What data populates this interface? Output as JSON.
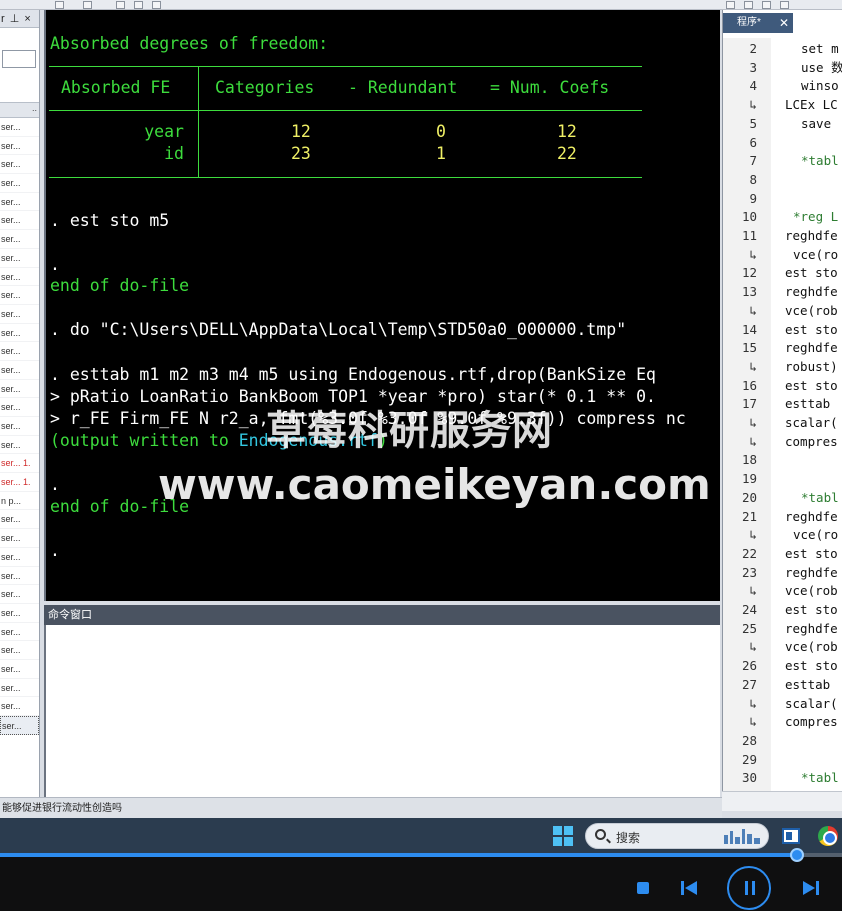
{
  "left_panel": {
    "header": "r ⊥ ×",
    "col_header": "..",
    "rows": [
      {
        "text": "ser...",
        "style": "normal"
      },
      {
        "text": "ser...",
        "style": "normal"
      },
      {
        "text": "ser...",
        "style": "normal"
      },
      {
        "text": "ser...",
        "style": "normal"
      },
      {
        "text": "ser...",
        "style": "normal"
      },
      {
        "text": "ser...",
        "style": "normal"
      },
      {
        "text": "ser...",
        "style": "normal"
      },
      {
        "text": "ser...",
        "style": "normal"
      },
      {
        "text": "ser...",
        "style": "normal"
      },
      {
        "text": "ser...",
        "style": "normal"
      },
      {
        "text": "ser...",
        "style": "normal"
      },
      {
        "text": "ser...",
        "style": "normal"
      },
      {
        "text": "ser...",
        "style": "normal"
      },
      {
        "text": "ser...",
        "style": "normal"
      },
      {
        "text": "ser...",
        "style": "normal"
      },
      {
        "text": "ser...",
        "style": "normal"
      },
      {
        "text": "ser...",
        "style": "normal"
      },
      {
        "text": "ser...",
        "style": "normal"
      },
      {
        "text": "ser... 1.",
        "style": "red"
      },
      {
        "text": "ser... 1.",
        "style": "red"
      },
      {
        "text": "n p...",
        "style": "normal"
      },
      {
        "text": "ser...",
        "style": "normal"
      },
      {
        "text": "ser...",
        "style": "normal"
      },
      {
        "text": "ser...",
        "style": "normal"
      },
      {
        "text": "ser...",
        "style": "normal"
      },
      {
        "text": "ser...",
        "style": "normal"
      },
      {
        "text": "ser...",
        "style": "normal"
      },
      {
        "text": "ser...",
        "style": "normal"
      },
      {
        "text": "ser...",
        "style": "normal"
      },
      {
        "text": "ser...",
        "style": "normal"
      },
      {
        "text": "ser...",
        "style": "normal"
      },
      {
        "text": "ser...",
        "style": "normal"
      },
      {
        "text": "ser...",
        "style": "sel"
      }
    ]
  },
  "results": {
    "absorbed_title": "Absorbed degrees of freedom:",
    "table": {
      "headers": [
        "Absorbed FE",
        "Categories",
        "- Redundant",
        "= Num. Coefs"
      ],
      "rows": [
        {
          "fe": "year",
          "categories": "12",
          "redundant": "0",
          "coefs": "12"
        },
        {
          "fe": "id",
          "categories": "23",
          "redundant": "1",
          "coefs": "22"
        }
      ]
    },
    "cmd_est_sto": ". est sto m5",
    "dot1": ".",
    "end_do1": "end of do-file",
    "cmd_do": ". do \"C:\\Users\\DELL\\AppData\\Local\\Temp\\STD50a0_000000.tmp\"",
    "cmd_esttab": ". esttab m1 m2 m3 m4 m5 using Endogenous.rtf,drop(BankSize Eq",
    "cont1": "> pRatio LoanRatio BankBoom TOP1 *year *pro) star(* 0.1 ** 0.",
    "cont2": "> r_FE Firm_FE N r2_a, fmt(%3.0f %3.0f %9.0f %9.3f)) compress nc",
    "output_prefix": "(output written to ",
    "output_file": "Endogenous.rtf",
    "output_suffix": ")",
    "dot2": ".",
    "end_do2": "end of do-file",
    "dot3": "."
  },
  "command_window": {
    "title": "命令窗口"
  },
  "editor": {
    "tab_label": "程序*",
    "lines": [
      {
        "num": "2",
        "code": "set m",
        "style": "code",
        "indent": 1
      },
      {
        "num": "3",
        "code": "use 数",
        "style": "code",
        "indent": 1
      },
      {
        "num": "4",
        "code": "winso",
        "style": "code",
        "indent": 1
      },
      {
        "num": "↳",
        "code": "LCEx LC",
        "style": "code",
        "indent": 0
      },
      {
        "num": "5",
        "code": "save ",
        "style": "code",
        "indent": 1
      },
      {
        "num": "6",
        "code": "",
        "style": "code",
        "indent": 0
      },
      {
        "num": "7",
        "code": "*tabl",
        "style": "comment",
        "indent": 1
      },
      {
        "num": "8",
        "code": "",
        "style": "code",
        "indent": 0
      },
      {
        "num": "9",
        "code": "",
        "style": "code",
        "indent": 0
      },
      {
        "num": "10",
        "code": "*reg L",
        "style": "comment",
        "indent": 0.5
      },
      {
        "num": "11",
        "code": "reghdfe",
        "style": "code",
        "indent": 0
      },
      {
        "num": "↳",
        "code": "vce(ro",
        "style": "code",
        "indent": 0.5
      },
      {
        "num": "12",
        "code": "est sto",
        "style": "code",
        "indent": 0
      },
      {
        "num": "13",
        "code": "reghdfe",
        "style": "code",
        "indent": 0
      },
      {
        "num": "↳",
        "code": "vce(rob",
        "style": "code",
        "indent": 0
      },
      {
        "num": "14",
        "code": "est sto",
        "style": "code",
        "indent": 0
      },
      {
        "num": "15",
        "code": "reghdfe",
        "style": "code",
        "indent": 0
      },
      {
        "num": "↳",
        "code": "robust)",
        "style": "code",
        "indent": 0
      },
      {
        "num": "16",
        "code": "est sto",
        "style": "code",
        "indent": 0
      },
      {
        "num": "17",
        "code": "esttab ",
        "style": "code",
        "indent": 0
      },
      {
        "num": "↳",
        "code": "scalar(",
        "style": "code",
        "indent": 0
      },
      {
        "num": "↳",
        "code": "compres",
        "style": "code",
        "indent": 0
      },
      {
        "num": "18",
        "code": "",
        "style": "code",
        "indent": 0
      },
      {
        "num": "19",
        "code": "",
        "style": "code",
        "indent": 0
      },
      {
        "num": "20",
        "code": "*tabl",
        "style": "comment",
        "indent": 1
      },
      {
        "num": "21",
        "code": "reghdfe",
        "style": "code",
        "indent": 0
      },
      {
        "num": "↳",
        "code": "vce(ro",
        "style": "code",
        "indent": 0.5
      },
      {
        "num": "22",
        "code": "est sto",
        "style": "code",
        "indent": 0
      },
      {
        "num": "23",
        "code": "reghdfe",
        "style": "code",
        "indent": 0
      },
      {
        "num": "↳",
        "code": "vce(rob",
        "style": "code",
        "indent": 0
      },
      {
        "num": "24",
        "code": "est sto",
        "style": "code",
        "indent": 0
      },
      {
        "num": "25",
        "code": "reghdfe",
        "style": "code",
        "indent": 0
      },
      {
        "num": "↳",
        "code": "vce(rob",
        "style": "code",
        "indent": 0
      },
      {
        "num": "26",
        "code": "est sto",
        "style": "code",
        "indent": 0
      },
      {
        "num": "27",
        "code": "esttab ",
        "style": "code",
        "indent": 0
      },
      {
        "num": "↳",
        "code": "scalar(",
        "style": "code",
        "indent": 0
      },
      {
        "num": "↳",
        "code": "compres",
        "style": "code",
        "indent": 0
      },
      {
        "num": "28",
        "code": "",
        "style": "code",
        "indent": 0
      },
      {
        "num": "29",
        "code": "",
        "style": "code",
        "indent": 0
      },
      {
        "num": "30",
        "code": "*tabl",
        "style": "comment",
        "indent": 1
      }
    ]
  },
  "status_bar": {
    "text": "能够促进银行流动性创造吗"
  },
  "taskbar": {
    "search_label": "搜索"
  },
  "player": {
    "progress": 0.947
  },
  "watermark": {
    "cn": "草莓科研服务网",
    "url": "www.caomeikeyan.com"
  },
  "colors": {
    "green": "#3ddc3d",
    "yellow": "#f0f066",
    "cyan": "#33c7e0",
    "accent": "#2d8cf0"
  }
}
